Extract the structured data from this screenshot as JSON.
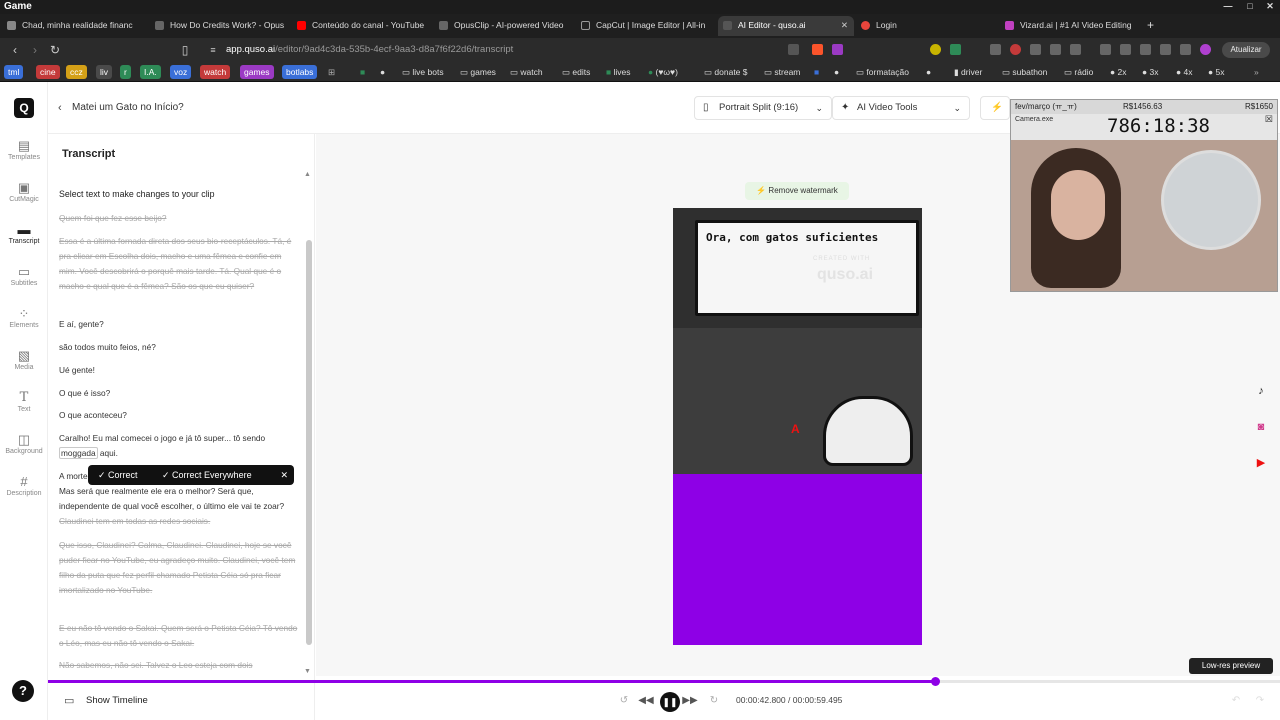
{
  "window": {
    "title": "Game"
  },
  "tabs": [
    {
      "label": "Chad, minha realidade financ",
      "color": "#888888"
    },
    {
      "label": "How Do Credits Work? - Opus",
      "color": "#666666"
    },
    {
      "label": "Conteúdo do canal - YouTube",
      "color": "#ff0000"
    },
    {
      "label": "OpusClip - AI-powered Video",
      "color": "#666666"
    },
    {
      "label": "CapCut | Image Editor | All-in",
      "color": "#222222"
    },
    {
      "label": "AI Editor - quso.ai",
      "color": "#555555"
    },
    {
      "label": "Login",
      "color": "#e8453c"
    },
    {
      "label": "Vizard.ai | #1 AI Video Editing",
      "color": "#c040c0"
    }
  ],
  "address": {
    "host": "app.quso.ai",
    "path": "/editor/9ad4c3da-535b-4ecf-9aa3-d8a7f6f22d6/transcript",
    "update_label": "Atualizar"
  },
  "bookmarks": [
    {
      "label": "tml",
      "color": "#3a6fd8"
    },
    {
      "label": "cine",
      "color": "#c43a3a"
    },
    {
      "label": "ccz",
      "color": "#d4a017"
    },
    {
      "label": "liv",
      "color": "#4a4a4a"
    },
    {
      "label": "r",
      "color": "#2e8b57"
    },
    {
      "label": "I.A.",
      "color": "#2e8b57"
    },
    {
      "label": "voz",
      "color": "#3a6fd8"
    },
    {
      "label": "watch",
      "color": "#c43a3a"
    },
    {
      "label": "games",
      "color": "#9b3ac4"
    },
    {
      "label": "botlabs",
      "color": "#3a6fd8"
    },
    {
      "label": "live bots",
      "color": ""
    },
    {
      "label": "games",
      "color": ""
    },
    {
      "label": "watch",
      "color": ""
    },
    {
      "label": "edits",
      "color": ""
    },
    {
      "label": "lives",
      "color": ""
    },
    {
      "label": "(♥ω♥)",
      "color": ""
    },
    {
      "label": "donate $",
      "color": ""
    },
    {
      "label": "stream",
      "color": ""
    },
    {
      "label": "formatação",
      "color": ""
    },
    {
      "label": "driver",
      "color": ""
    },
    {
      "label": "subathon",
      "color": ""
    },
    {
      "label": "rádio",
      "color": ""
    },
    {
      "label": "2x",
      "color": ""
    },
    {
      "label": "3x",
      "color": ""
    },
    {
      "label": "4x",
      "color": ""
    },
    {
      "label": "5x",
      "color": ""
    }
  ],
  "rail": {
    "items": [
      {
        "label": "Templates",
        "icon": "templates-icon"
      },
      {
        "label": "CutMagic",
        "icon": "cutmagic-icon"
      },
      {
        "label": "Transcript",
        "icon": "transcript-icon"
      },
      {
        "label": "Subtitles",
        "icon": "subtitles-icon"
      },
      {
        "label": "Elements",
        "icon": "elements-icon"
      },
      {
        "label": "Media",
        "icon": "media-icon"
      },
      {
        "label": "Text",
        "icon": "text-icon"
      },
      {
        "label": "Background",
        "icon": "background-icon"
      },
      {
        "label": "Description",
        "icon": "description-icon"
      }
    ],
    "help_label": "?"
  },
  "topbar": {
    "project_title": "Matei um Gato no Início?",
    "layout_label": "Portrait Split (9:16)",
    "tools_label": "AI Video Tools"
  },
  "transcript": {
    "title": "Transcript",
    "instruction": "Select text to make changes to your clip",
    "lines": [
      "Quem foi que fez esse beijo?",
      "Essa é a última fornada direta dos seus bio-receptáculos. Tá, é pra clicar em Escolha dois, macho e uma fêmea e confie em mim. Você descobrirá o porquê mais tarde. Tá. Qual que é o macho e qual que é a fêmea? São os que eu quiser?",
      "E aí, gente?",
      "são todos muito feios, né?",
      "Ué gente!",
      "O que é isso?",
      "O que aconteceu?",
      "Caralho! Eu mal comecei o jogo e já tô super... tô sendo",
      "moggada",
      "aqui.",
      "A morte",
      "Mas será que realmente ele era o melhor? Será que, independente de qual você escolher, o último ele vai te zoar?",
      "Claudinei tem em todas as redes sociais.",
      "Que isso, Claudinei? Calma, Claudinei. Claudinei, hoje se você puder ficar no YouTube, eu agradeço muito. Claudinei, você tem filho da puta que fez perfil chamado Petista Céia só pra ficar imortalizado no YouTube.",
      "E eu não tô vendo o Sakai. Quem será o Petista Céia? Tô vendo o Léo, mas eu não tô vendo o Sakai.",
      "Não sabemos, não sei. Talvez o Leo esteja com dois"
    ],
    "popup": {
      "correct": "Correct",
      "correct_everywhere": "Correct Everywhere"
    }
  },
  "preview": {
    "remove_watermark": "Remove watermark",
    "caption": "Ora, com gatos suficientes",
    "created_with": "CREATED WITH",
    "brand": "quso.ai",
    "marker": "A",
    "low_res": "Low-res preview"
  },
  "webcam": {
    "label": "fev/março (ㅠ_ㅠ)",
    "amount": "R$1456.63",
    "amount2": "R$1650",
    "camera": "Camera.exe",
    "timer": "786:18:38"
  },
  "playback": {
    "show_timeline": "Show Timeline",
    "current": "00:00:42.800",
    "total": "00:00:59.495",
    "separator": "/",
    "progress": 0.72
  },
  "colors": {
    "accent": "#8e00e6"
  }
}
